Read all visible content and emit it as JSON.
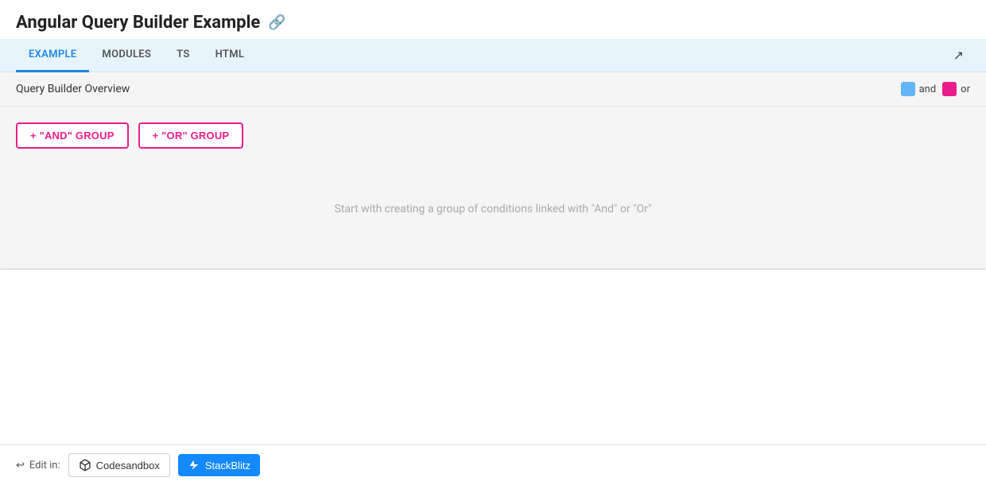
{
  "page": {
    "title": "Angular Query Builder Example",
    "link_icon": "🔗"
  },
  "tabs": {
    "items": [
      {
        "label": "EXAMPLE",
        "active": true
      },
      {
        "label": "MODULES",
        "active": false
      },
      {
        "label": "TS",
        "active": false
      },
      {
        "label": "HTML",
        "active": false
      }
    ],
    "expand_icon": "↗"
  },
  "panel": {
    "title": "Query Builder Overview",
    "legend": [
      {
        "label": "and",
        "color": "#64b5f6"
      },
      {
        "label": "or",
        "color": "#e91e8c"
      }
    ]
  },
  "buttons": {
    "and_group": "+ \"AND\" GROUP",
    "or_group": "+ \"OR\" GROUP"
  },
  "empty_state": {
    "message": "Start with creating a group of conditions linked with \"And\" or \"Or\""
  },
  "footer": {
    "edit_in_label": "Edit in:",
    "codesandbox_label": "Codesandbox",
    "stackblitz_label": "StackBlitz"
  }
}
